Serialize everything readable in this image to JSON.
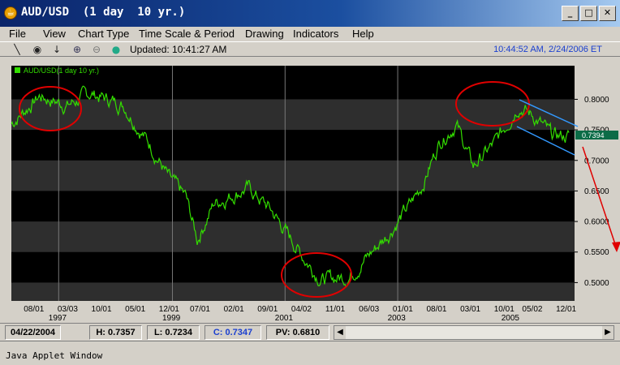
{
  "window": {
    "title": "AUD/USD  (1 day  10 yr.)",
    "app_icon": "java-coffee-icon",
    "controls": {
      "minimize": "_",
      "maximize": "□",
      "close": "✕"
    }
  },
  "menu": [
    "File",
    "View",
    "Chart Type",
    "Time Scale & Period",
    "Drawing",
    "Indicators",
    "Help"
  ],
  "toolbar": {
    "tools": [
      "line-tool-icon",
      "crosshair-tool-icon",
      "download-arrow-icon",
      "zoom-in-icon",
      "zoom-out-icon",
      "pan-hand-icon"
    ],
    "updated": "Updated: 10:41:27 AM",
    "clock": "10:44:52 AM, 2/24/2006 ET"
  },
  "chart_data": {
    "type": "line",
    "legend": "AUD/USD(1 day  10 yr.)",
    "series_color": "#33dd00",
    "ylim": [
      0.47,
      0.855
    ],
    "yticks": [
      "0.8000",
      "0.7500",
      "0.7000",
      "0.6500",
      "0.6000",
      "0.5500",
      "0.5000"
    ],
    "last_value": "0.7394",
    "x_ticks": [
      "08/01",
      "03/03",
      "10/01",
      "05/01",
      "12/01",
      "07/01",
      "02/01",
      "09/01",
      "04/02",
      "11/01",
      "06/03",
      "01/01",
      "08/01",
      "03/01",
      "10/01",
      "05/02",
      "12/01"
    ],
    "x_years": [
      "1997",
      "1999",
      "2001",
      "2003",
      "2005"
    ],
    "x": [
      0,
      0.05,
      0.1,
      0.14,
      0.2,
      0.25,
      0.28,
      0.31,
      0.33,
      0.36,
      0.42,
      0.46,
      0.52,
      0.55,
      0.6,
      0.64,
      0.67,
      0.71,
      0.73,
      0.76,
      0.79,
      0.82,
      0.86,
      0.9,
      0.93,
      0.96,
      0.99
    ],
    "y": [
      0.76,
      0.805,
      0.79,
      0.81,
      0.79,
      0.72,
      0.67,
      0.64,
      0.57,
      0.63,
      0.655,
      0.62,
      0.54,
      0.505,
      0.51,
      0.55,
      0.58,
      0.63,
      0.66,
      0.73,
      0.76,
      0.69,
      0.73,
      0.79,
      0.77,
      0.74,
      0.74
    ],
    "annotations": [
      "ellipse top 1997",
      "ellipse bottom 2001",
      "ellipse top 2005",
      "downtrend channel",
      "projection arrow"
    ],
    "grid": true
  },
  "status": {
    "date": "04/22/2004",
    "high": "H: 0.7357",
    "low": "L: 0.7234",
    "close": "C: 0.7347",
    "pv": "PV: 0.6810"
  },
  "footer": "Java Applet Window"
}
